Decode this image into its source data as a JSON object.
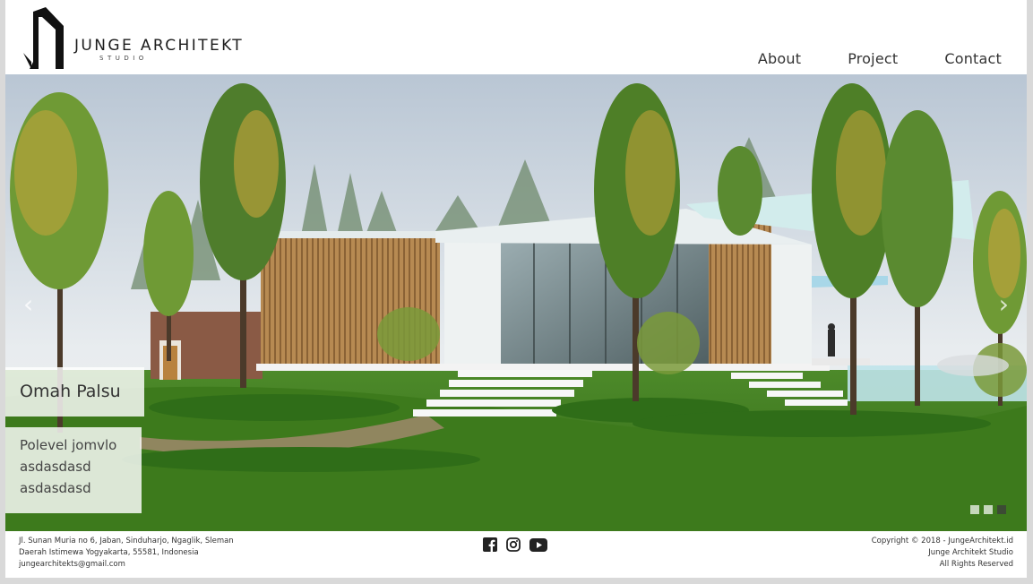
{
  "brand": {
    "name": "JUNGE ARCHITEKT",
    "subtitle": "STUDIO"
  },
  "nav": {
    "items": [
      {
        "label": "About"
      },
      {
        "label": "Project"
      },
      {
        "label": "Contact"
      }
    ]
  },
  "slider": {
    "prev_icon": "chevron-left-icon",
    "next_icon": "chevron-right-icon",
    "caption": {
      "title": "Omah Palsu",
      "lines": [
        "Polevel jomvlo",
        "asdasdasd",
        "asdasdasd"
      ]
    },
    "slide_count": 3,
    "active_index": 2
  },
  "footer": {
    "address": [
      "Jl. Sunan Muria no 6, Jaban, Sinduharjo, Ngaglik, Sleman",
      "Daerah Istimewa Yogyakarta, 55581, Indonesia",
      "jungearchitekts@gmail.com"
    ],
    "social": [
      "facebook-icon",
      "instagram-icon",
      "youtube-icon"
    ],
    "copyright": [
      "Copyright © 2018 - JungeArchitekt.id",
      "Junge Architekt Studio",
      "All Rights Reserved"
    ]
  },
  "colors": {
    "text": "#333333",
    "background": "#ffffff",
    "page_border": "#d9d9d9"
  }
}
